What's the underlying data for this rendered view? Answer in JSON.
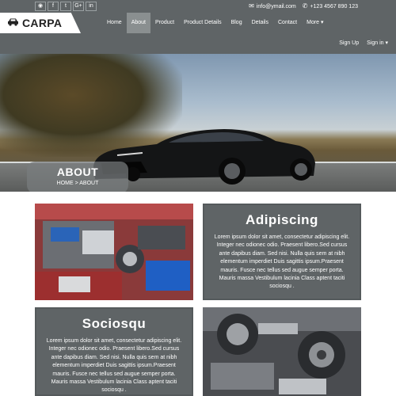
{
  "topbar": {
    "social": [
      {
        "icon": "rss-icon",
        "glyph": "◉"
      },
      {
        "icon": "facebook-icon",
        "glyph": "f"
      },
      {
        "icon": "twitter-icon",
        "glyph": "t"
      },
      {
        "icon": "google-plus-icon",
        "glyph": "G+"
      },
      {
        "icon": "linkedin-icon",
        "glyph": "in"
      }
    ],
    "email": "info@ymail.com",
    "phone": "+123 4567 890 123"
  },
  "brand": {
    "name": "CARPA"
  },
  "nav": {
    "items": [
      "Home",
      "About",
      "Product",
      "Product Details",
      "Blog",
      "Details",
      "Contact",
      "More ▾"
    ],
    "active": "About"
  },
  "auth": {
    "signup": "Sign Up",
    "signin": "Sign in ▾"
  },
  "hero": {
    "title": "ABOUT",
    "breadcrumb": "HOME > ABOUT"
  },
  "cards": [
    {
      "title": "Adipiscing",
      "text": "Lorem ipsum dolor sit amet, consectetur adipiscing elit. Integer nec odionec odio. Praesent libero.Sed cursus ante dapibus diam. Sed nisi. Nulla quis sem at nibh elementum imperdiet Duis sagittis ipsum.Praesent mauris. Fusce nec tellus sed augue semper porta. Mauris massa Vestibulum lacinia Class aptent taciti sociosqu ."
    },
    {
      "title": "Sociosqu",
      "text": "Lorem ipsum dolor sit amet, consectetur adipiscing elit. Integer nec odionec odio. Praesent libero.Sed cursus ante dapibus diam. Sed nisi. Nulla quis sem at nibh elementum imperdiet Duis sagittis ipsum.Praesent mauris. Fusce nec tellus sed augue semper porta. Mauris massa Vestibulum lacinia Class aptent taciti sociosqu ."
    }
  ]
}
